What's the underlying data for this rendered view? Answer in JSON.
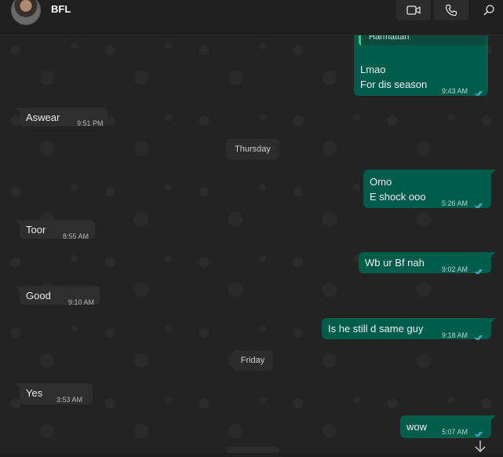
{
  "header": {
    "contact_name": "BFL",
    "icons": [
      "video-call-icon",
      "voice-call-icon",
      "search-icon"
    ]
  },
  "dates": {
    "thursday": "Thursday",
    "friday": "Friday"
  },
  "messages": {
    "m1": {
      "quote": "Harmattan",
      "line1": "Lmao",
      "line2": "For dis season",
      "time": "9:43 AM"
    },
    "m2": {
      "text": "Aswear",
      "time": "9:51 PM"
    },
    "m3": {
      "line1": "Omo",
      "line2": "E shock ooo",
      "time": "5:26 AM"
    },
    "m4": {
      "text": "Toor",
      "time": "8:55 AM"
    },
    "m5": {
      "text": "Wb ur Bf nah",
      "time": "9:02 AM"
    },
    "m6": {
      "text": "Good",
      "time": "9:10 AM"
    },
    "m7": {
      "text": "Is he still d same guy",
      "time": "9:18 AM"
    },
    "m8": {
      "text": "Yes",
      "time": "3:53 AM"
    },
    "m9": {
      "text": "wow",
      "time": "5:07 AM"
    }
  },
  "colors": {
    "incoming_bubble": "#2e2e2e",
    "outgoing_bubble": "#005c4b",
    "read_ticks": "#53bdeb",
    "background": "#232323"
  }
}
